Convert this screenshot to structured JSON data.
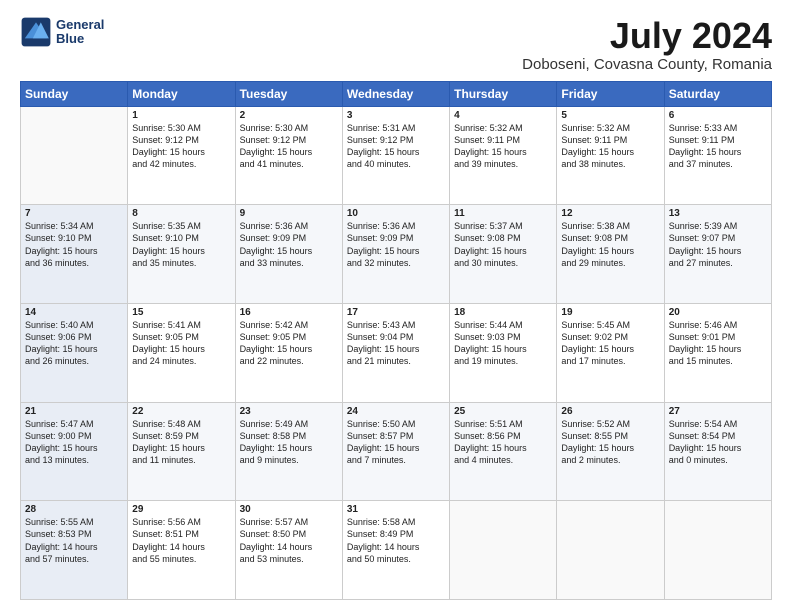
{
  "logo": {
    "line1": "General",
    "line2": "Blue"
  },
  "title": "July 2024",
  "subtitle": "Doboseni, Covasna County, Romania",
  "header_row": [
    "Sunday",
    "Monday",
    "Tuesday",
    "Wednesday",
    "Thursday",
    "Friday",
    "Saturday"
  ],
  "weeks": [
    [
      {
        "day": "",
        "info": ""
      },
      {
        "day": "1",
        "info": "Sunrise: 5:30 AM\nSunset: 9:12 PM\nDaylight: 15 hours\nand 42 minutes."
      },
      {
        "day": "2",
        "info": "Sunrise: 5:30 AM\nSunset: 9:12 PM\nDaylight: 15 hours\nand 41 minutes."
      },
      {
        "day": "3",
        "info": "Sunrise: 5:31 AM\nSunset: 9:12 PM\nDaylight: 15 hours\nand 40 minutes."
      },
      {
        "day": "4",
        "info": "Sunrise: 5:32 AM\nSunset: 9:11 PM\nDaylight: 15 hours\nand 39 minutes."
      },
      {
        "day": "5",
        "info": "Sunrise: 5:32 AM\nSunset: 9:11 PM\nDaylight: 15 hours\nand 38 minutes."
      },
      {
        "day": "6",
        "info": "Sunrise: 5:33 AM\nSunset: 9:11 PM\nDaylight: 15 hours\nand 37 minutes."
      }
    ],
    [
      {
        "day": "7",
        "info": "Sunrise: 5:34 AM\nSunset: 9:10 PM\nDaylight: 15 hours\nand 36 minutes."
      },
      {
        "day": "8",
        "info": "Sunrise: 5:35 AM\nSunset: 9:10 PM\nDaylight: 15 hours\nand 35 minutes."
      },
      {
        "day": "9",
        "info": "Sunrise: 5:36 AM\nSunset: 9:09 PM\nDaylight: 15 hours\nand 33 minutes."
      },
      {
        "day": "10",
        "info": "Sunrise: 5:36 AM\nSunset: 9:09 PM\nDaylight: 15 hours\nand 32 minutes."
      },
      {
        "day": "11",
        "info": "Sunrise: 5:37 AM\nSunset: 9:08 PM\nDaylight: 15 hours\nand 30 minutes."
      },
      {
        "day": "12",
        "info": "Sunrise: 5:38 AM\nSunset: 9:08 PM\nDaylight: 15 hours\nand 29 minutes."
      },
      {
        "day": "13",
        "info": "Sunrise: 5:39 AM\nSunset: 9:07 PM\nDaylight: 15 hours\nand 27 minutes."
      }
    ],
    [
      {
        "day": "14",
        "info": "Sunrise: 5:40 AM\nSunset: 9:06 PM\nDaylight: 15 hours\nand 26 minutes."
      },
      {
        "day": "15",
        "info": "Sunrise: 5:41 AM\nSunset: 9:05 PM\nDaylight: 15 hours\nand 24 minutes."
      },
      {
        "day": "16",
        "info": "Sunrise: 5:42 AM\nSunset: 9:05 PM\nDaylight: 15 hours\nand 22 minutes."
      },
      {
        "day": "17",
        "info": "Sunrise: 5:43 AM\nSunset: 9:04 PM\nDaylight: 15 hours\nand 21 minutes."
      },
      {
        "day": "18",
        "info": "Sunrise: 5:44 AM\nSunset: 9:03 PM\nDaylight: 15 hours\nand 19 minutes."
      },
      {
        "day": "19",
        "info": "Sunrise: 5:45 AM\nSunset: 9:02 PM\nDaylight: 15 hours\nand 17 minutes."
      },
      {
        "day": "20",
        "info": "Sunrise: 5:46 AM\nSunset: 9:01 PM\nDaylight: 15 hours\nand 15 minutes."
      }
    ],
    [
      {
        "day": "21",
        "info": "Sunrise: 5:47 AM\nSunset: 9:00 PM\nDaylight: 15 hours\nand 13 minutes."
      },
      {
        "day": "22",
        "info": "Sunrise: 5:48 AM\nSunset: 8:59 PM\nDaylight: 15 hours\nand 11 minutes."
      },
      {
        "day": "23",
        "info": "Sunrise: 5:49 AM\nSunset: 8:58 PM\nDaylight: 15 hours\nand 9 minutes."
      },
      {
        "day": "24",
        "info": "Sunrise: 5:50 AM\nSunset: 8:57 PM\nDaylight: 15 hours\nand 7 minutes."
      },
      {
        "day": "25",
        "info": "Sunrise: 5:51 AM\nSunset: 8:56 PM\nDaylight: 15 hours\nand 4 minutes."
      },
      {
        "day": "26",
        "info": "Sunrise: 5:52 AM\nSunset: 8:55 PM\nDaylight: 15 hours\nand 2 minutes."
      },
      {
        "day": "27",
        "info": "Sunrise: 5:54 AM\nSunset: 8:54 PM\nDaylight: 15 hours\nand 0 minutes."
      }
    ],
    [
      {
        "day": "28",
        "info": "Sunrise: 5:55 AM\nSunset: 8:53 PM\nDaylight: 14 hours\nand 57 minutes."
      },
      {
        "day": "29",
        "info": "Sunrise: 5:56 AM\nSunset: 8:51 PM\nDaylight: 14 hours\nand 55 minutes."
      },
      {
        "day": "30",
        "info": "Sunrise: 5:57 AM\nSunset: 8:50 PM\nDaylight: 14 hours\nand 53 minutes."
      },
      {
        "day": "31",
        "info": "Sunrise: 5:58 AM\nSunset: 8:49 PM\nDaylight: 14 hours\nand 50 minutes."
      },
      {
        "day": "",
        "info": ""
      },
      {
        "day": "",
        "info": ""
      },
      {
        "day": "",
        "info": ""
      }
    ]
  ]
}
